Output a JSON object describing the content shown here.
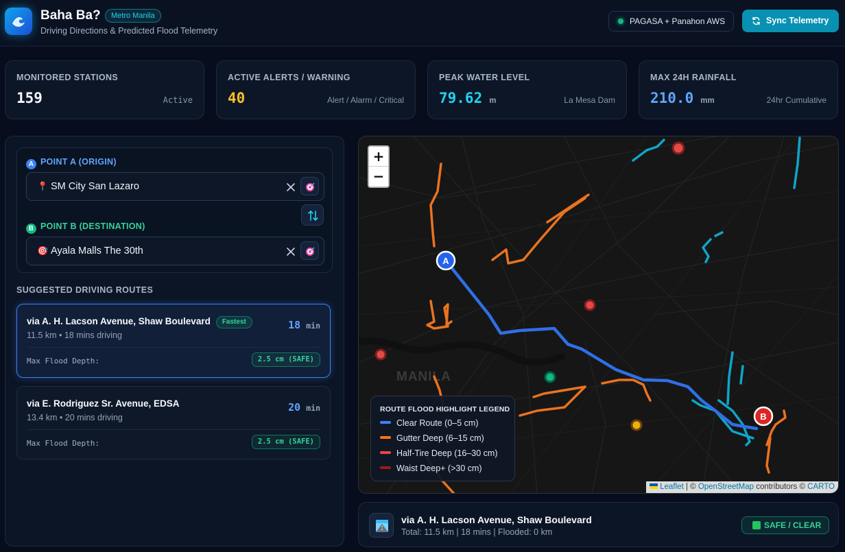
{
  "header": {
    "app_title": "Baha Ba?",
    "region_badge": "Metro Manila",
    "subtitle": "Driving Directions & Predicted Flood Telemetry",
    "data_source": "PAGASA + Panahon AWS",
    "sync_label": "Sync Telemetry"
  },
  "stats": [
    {
      "label": "MONITORED STATIONS",
      "value": "159",
      "unit": "",
      "note": "Active",
      "color": "#f8fafc"
    },
    {
      "label": "ACTIVE ALERTS / WARNING",
      "value": "40",
      "unit": "",
      "note": "Alert / Alarm / Critical",
      "color": "#fbbf24"
    },
    {
      "label": "PEAK WATER LEVEL",
      "value": "79.62",
      "unit": "m",
      "note": "La Mesa Dam",
      "color": "#22d3ee"
    },
    {
      "label": "MAX 24H RAINFALL",
      "value": "210.0",
      "unit": "mm",
      "note": "24hr Cumulative",
      "color": "#60a5fa"
    }
  ],
  "origin": {
    "badge": "A",
    "label": "POINT A (ORIGIN)",
    "value": "SM City San Lazaro"
  },
  "destination": {
    "badge": "B",
    "label": "POINT B (DESTINATION)",
    "value": "Ayala Malls The 30th"
  },
  "routes": {
    "title": "SUGGESTED DRIVING ROUTES",
    "items": [
      {
        "name": "via A. H. Lacson Avenue, Shaw Boulevard",
        "tag": "Fastest",
        "meta": "11.5 km • 18 mins driving",
        "minutes": "18",
        "unit": "min",
        "flood_label": "Max Flood Depth:",
        "flood_value": "2.5 cm (SAFE)"
      },
      {
        "name": "via E. Rodriguez Sr. Avenue, EDSA",
        "tag": "",
        "meta": "13.4 km • 20 mins driving",
        "minutes": "20",
        "unit": "min",
        "flood_label": "Max Flood Depth:",
        "flood_value": "2.5 cm (SAFE)"
      }
    ]
  },
  "map": {
    "zoom_in": "+",
    "zoom_out": "−",
    "city_label": "MANILA",
    "marker_a": "A",
    "marker_b": "B",
    "legend": {
      "title": "ROUTE FLOOD HIGHLIGHT LEGEND",
      "items": [
        {
          "label": "Clear Route (0–5 cm)",
          "color": "#3b82f6"
        },
        {
          "label": "Gutter Deep (6–15 cm)",
          "color": "#f97316"
        },
        {
          "label": "Half-Tire Deep (16–30 cm)",
          "color": "#ef4444"
        },
        {
          "label": "Waist Deep+ (>30 cm)",
          "color": "#991b1b"
        }
      ]
    },
    "attribution": {
      "leaflet": "Leaflet",
      "sep1": " | © ",
      "osm": "OpenStreetMap",
      "mid": " contributors © ",
      "carto": "CARTO"
    }
  },
  "summary": {
    "route": "via A. H. Lacson Avenue, Shaw Boulevard",
    "meta": "Total: 11.5 km | 18 mins | Flooded: 0 km",
    "status": "SAFE / CLEAR"
  }
}
